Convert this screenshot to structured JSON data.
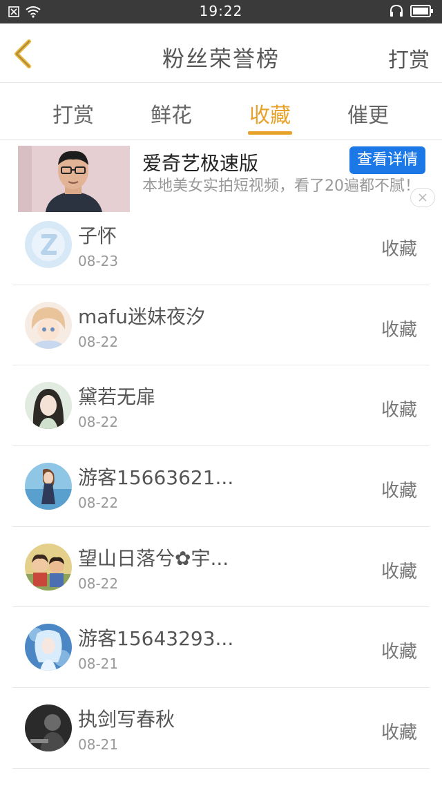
{
  "status_bar": {
    "time": "19:22"
  },
  "header": {
    "title": "粉丝荣誉榜",
    "right_action": "打赏"
  },
  "tabs": [
    {
      "label": "打赏",
      "active": false
    },
    {
      "label": "鲜花",
      "active": false
    },
    {
      "label": "收藏",
      "active": true
    },
    {
      "label": "催更",
      "active": false
    }
  ],
  "ad": {
    "title": "爱奇艺极速版",
    "button": "查看详情",
    "description": "本地美女实拍短视频，看了20遍都不腻！"
  },
  "list": [
    {
      "name": "子怀",
      "date": "08-23",
      "action": "收藏"
    },
    {
      "name": "mafu迷妹夜汐",
      "date": "08-22",
      "action": "收藏"
    },
    {
      "name": "黛若无扉",
      "date": "08-22",
      "action": "收藏"
    },
    {
      "name": "游客15663621...",
      "date": "08-22",
      "action": "收藏"
    },
    {
      "name": "望山日落兮✿宇...",
      "date": "08-22",
      "action": "收藏"
    },
    {
      "name": "游客15643293...",
      "date": "08-21",
      "action": "收藏"
    },
    {
      "name": "执剑写春秋",
      "date": "08-21",
      "action": "收藏"
    }
  ],
  "colors": {
    "accent": "#e8a12a",
    "status_bar": "#3a3a3a",
    "ad_button": "#1c78e6"
  }
}
